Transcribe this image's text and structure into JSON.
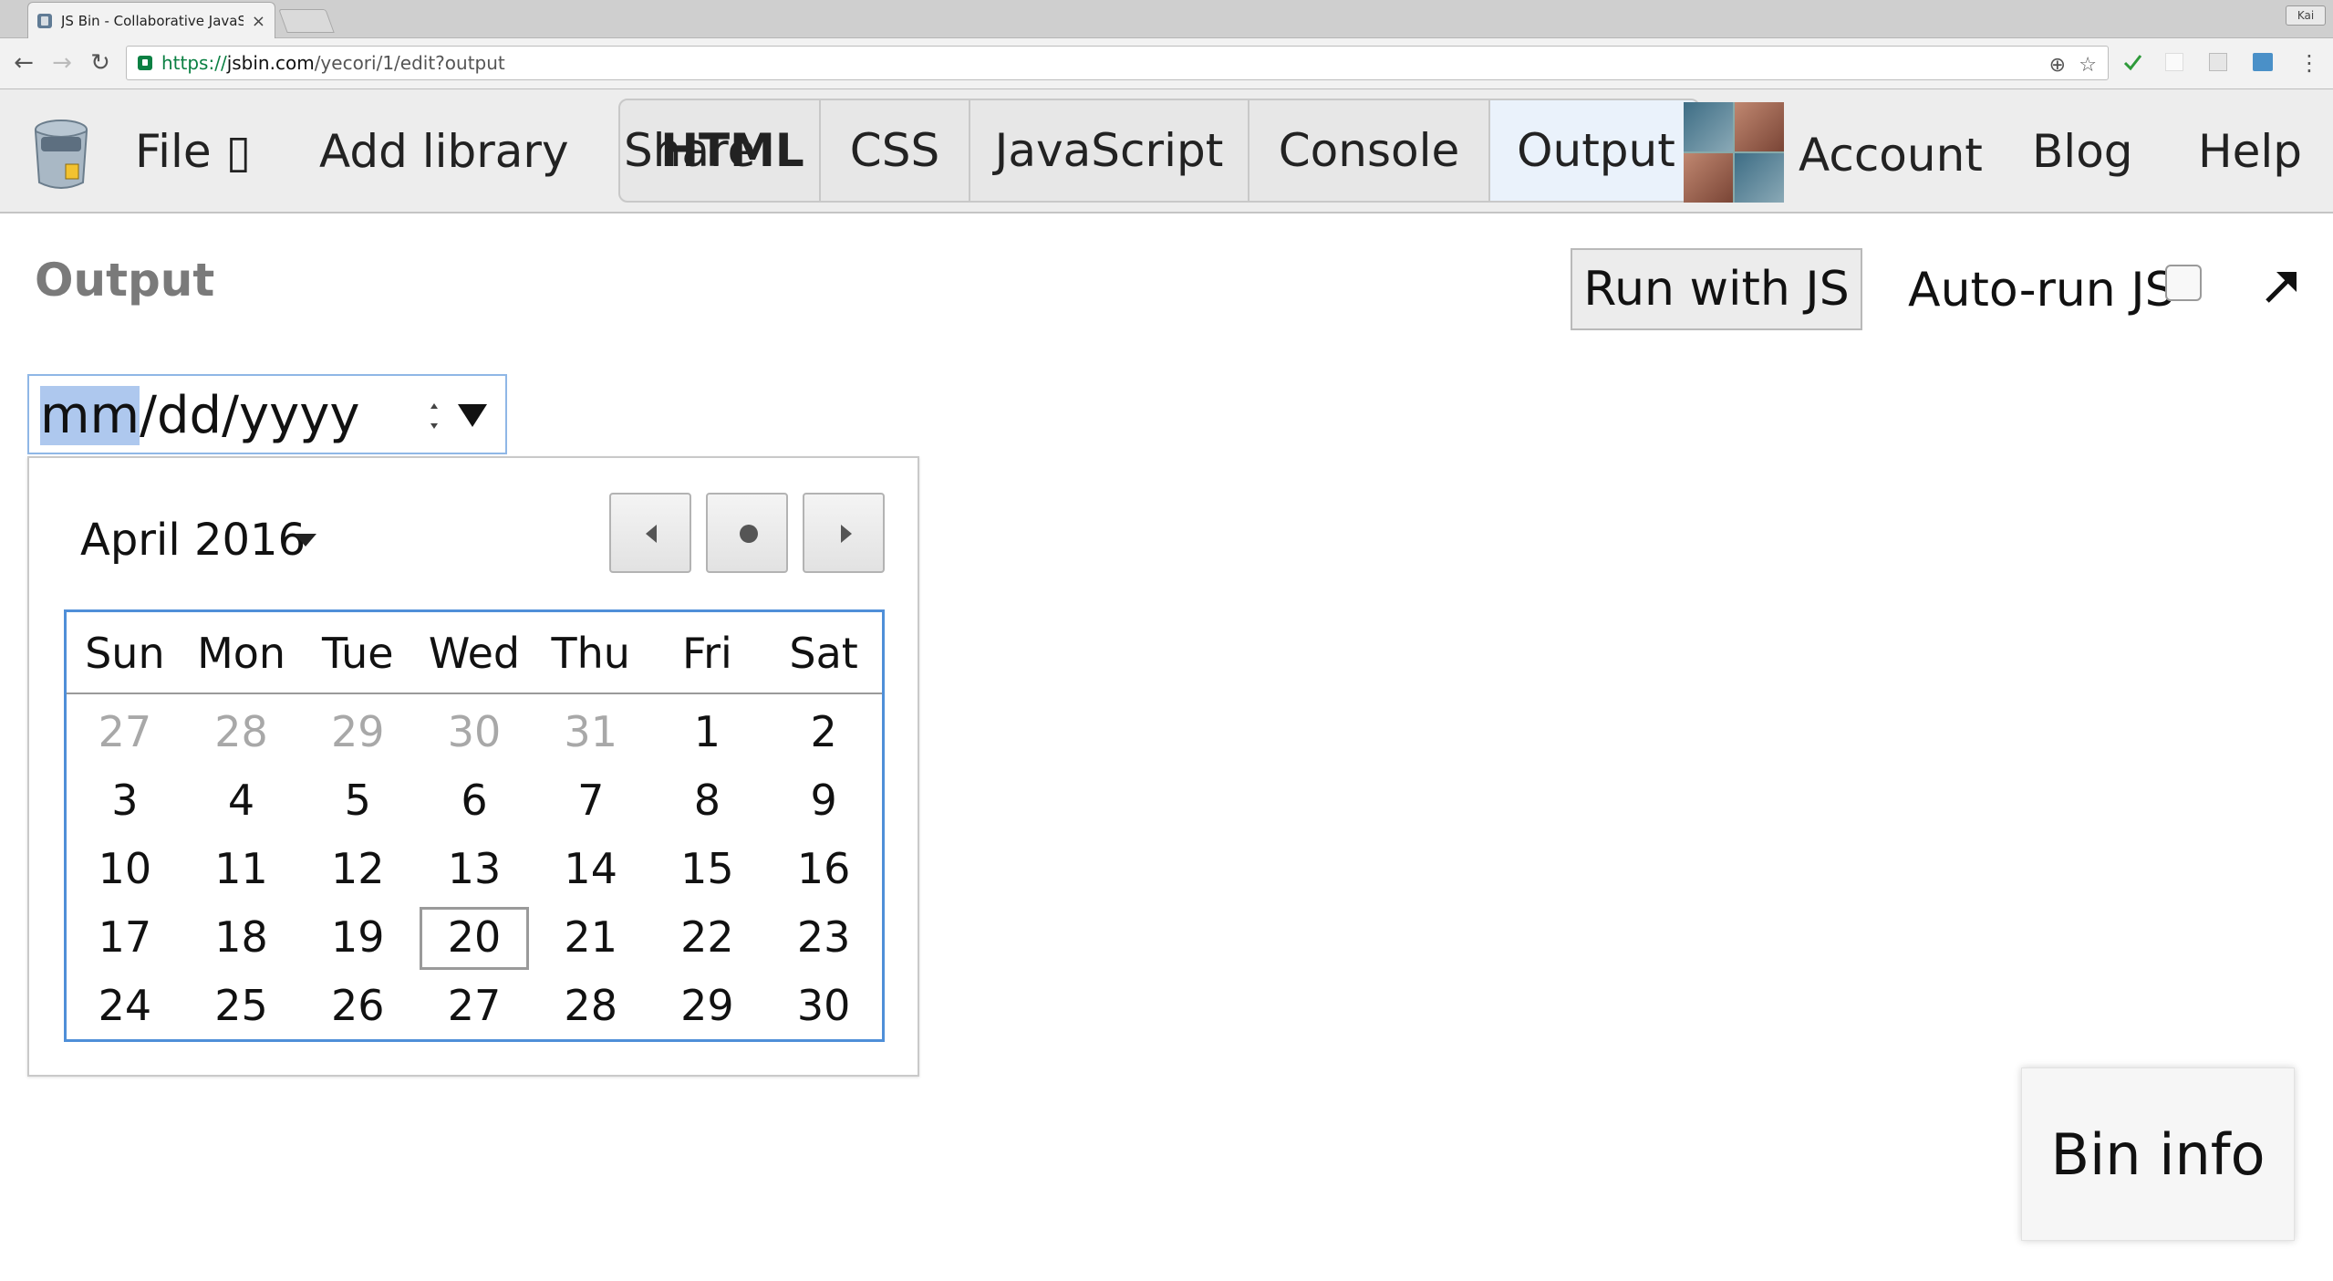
{
  "browser": {
    "tab_title": "JS Bin - Collaborative JavaScr",
    "tab_close": "×",
    "profile_name": "Kai",
    "url_scheme": "https://",
    "url_host": "jsbin.com",
    "url_path": "/yecori/1/edit?output"
  },
  "toolbar": {
    "file_label": "File",
    "file_glyph": "▯",
    "add_library_label": "Add library",
    "share_label": "Share",
    "panels": {
      "html": "HTML",
      "css": "CSS",
      "javascript": "JavaScript",
      "console": "Console",
      "output": "Output"
    },
    "account_label": "Account",
    "blog_label": "Blog",
    "help_label": "Help"
  },
  "output": {
    "title": "Output",
    "run_button": "Run with JS",
    "autorun_label": "Auto-run JS",
    "autorun_checked": false
  },
  "date_input": {
    "mm": "mm",
    "rest": "/dd/yyyy"
  },
  "calendar": {
    "month_label": "April 2016",
    "weekdays": [
      "Sun",
      "Mon",
      "Tue",
      "Wed",
      "Thu",
      "Fri",
      "Sat"
    ],
    "days": [
      {
        "d": "27",
        "other": true
      },
      {
        "d": "28",
        "other": true
      },
      {
        "d": "29",
        "other": true
      },
      {
        "d": "30",
        "other": true
      },
      {
        "d": "31",
        "other": true
      },
      {
        "d": "1"
      },
      {
        "d": "2"
      },
      {
        "d": "3"
      },
      {
        "d": "4"
      },
      {
        "d": "5"
      },
      {
        "d": "6"
      },
      {
        "d": "7"
      },
      {
        "d": "8"
      },
      {
        "d": "9"
      },
      {
        "d": "10"
      },
      {
        "d": "11"
      },
      {
        "d": "12"
      },
      {
        "d": "13"
      },
      {
        "d": "14"
      },
      {
        "d": "15"
      },
      {
        "d": "16"
      },
      {
        "d": "17"
      },
      {
        "d": "18"
      },
      {
        "d": "19"
      },
      {
        "d": "20",
        "today": true
      },
      {
        "d": "21"
      },
      {
        "d": "22"
      },
      {
        "d": "23"
      },
      {
        "d": "24"
      },
      {
        "d": "25"
      },
      {
        "d": "26"
      },
      {
        "d": "27"
      },
      {
        "d": "28"
      },
      {
        "d": "29"
      },
      {
        "d": "30"
      }
    ]
  },
  "bin_info_label": "Bin info",
  "colors": {
    "accent": "#4f8fd8",
    "selection": "#aec8ee",
    "output_title": "#7a7a7a"
  }
}
